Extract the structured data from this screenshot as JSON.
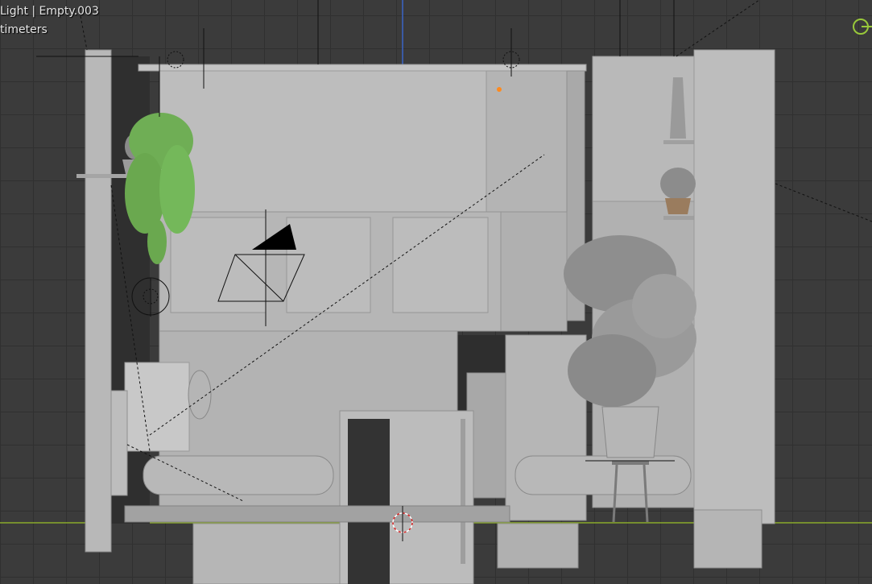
{
  "viewport": {
    "object_info": "Light | Empty.003",
    "units_label": "timeters"
  },
  "icons": {
    "light_icon": "light-gizmo-icon",
    "camera_icon": "camera-icon",
    "empty_icon": "empty-object-icon",
    "cursor_3d": "3d-cursor-icon",
    "navigation_gizmo": "navigation-gizmo-icon"
  },
  "colors": {
    "background": "#3b3b3b",
    "grid": "#303030",
    "x_axis": "#8aaa2a",
    "z_axis": "#3a64c8",
    "model": "#bdbdbd",
    "plant": "#74b85a",
    "gizmo_green": "#98c83a"
  }
}
